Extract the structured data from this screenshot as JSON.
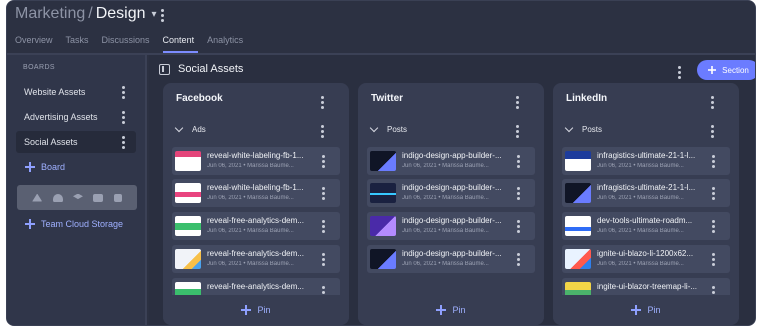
{
  "breadcrumb": {
    "parent": "Marketing",
    "separator": "/",
    "current": "Design"
  },
  "tabs": [
    {
      "label": "Overview"
    },
    {
      "label": "Tasks"
    },
    {
      "label": "Discussions"
    },
    {
      "label": "Content",
      "active": true
    },
    {
      "label": "Analytics"
    }
  ],
  "sidebar": {
    "heading": "BOARDS",
    "items": [
      {
        "label": "Website Assets"
      },
      {
        "label": "Advertising Assets"
      },
      {
        "label": "Social Assets",
        "active": true
      }
    ],
    "add_board_label": "Board",
    "storage_icons": [
      "google-drive-icon",
      "onedrive-icon",
      "dropbox-icon",
      "box-icon",
      "export-icon"
    ],
    "team_storage_label": "Team Cloud Storage"
  },
  "main": {
    "title": "Social Assets",
    "section_button_label": "Section",
    "accent_color": "#6b7cff"
  },
  "columns": [
    {
      "title": "Facebook",
      "group": "Ads",
      "cards": [
        {
          "name": "reveal-white-labeling-fb-1...",
          "meta": "Jun 06, 2021 • Marissa Baume..."
        },
        {
          "name": "reveal-white-labeling-fb-1...",
          "meta": "Jun 06, 2021 • Marissa Baume..."
        },
        {
          "name": "reveal-free-analytics-dem...",
          "meta": "Jun 06, 2021 • Marissa Baume..."
        },
        {
          "name": "reveal-free-analytics-dem...",
          "meta": "Jun 06, 2021 • Marissa Baume..."
        },
        {
          "name": "reveal-free-analytics-dem...",
          "meta": ""
        }
      ],
      "pin_label": "Pin"
    },
    {
      "title": "Twitter",
      "group": "Posts",
      "cards": [
        {
          "name": "indigo-design-app-builder-...",
          "meta": "Jun 06, 2021 • Marissa Baume..."
        },
        {
          "name": "indigo-design-app-builder-...",
          "meta": "Jun 06, 2021 • Marissa Baume..."
        },
        {
          "name": "indigo-design-app-builder-...",
          "meta": "Jun 06, 2021 • Marissa Baume..."
        },
        {
          "name": "indigo-design-app-builder-...",
          "meta": "Jun 06, 2021 • Marissa Baume..."
        }
      ],
      "pin_label": "Pin"
    },
    {
      "title": "LinkedIn",
      "group": "Posts",
      "cards": [
        {
          "name": "infragistics-ultimate-21-1-l...",
          "meta": "Jun 06, 2021 • Marissa Baume..."
        },
        {
          "name": "infragistics-ultimate-21-1-l...",
          "meta": "Jun 06, 2021 • Marissa Baume..."
        },
        {
          "name": "dev-tools-ultimate-roadm...",
          "meta": "Jun 06, 2021 • Marissa Baume..."
        },
        {
          "name": "ignite-ui-blazo-li-1200x62...",
          "meta": "Jun 06, 2021 • Marissa Baume..."
        },
        {
          "name": "ingite-ui-blazor-treemap-li-...",
          "meta": ""
        }
      ],
      "pin_label": "Pin"
    }
  ]
}
